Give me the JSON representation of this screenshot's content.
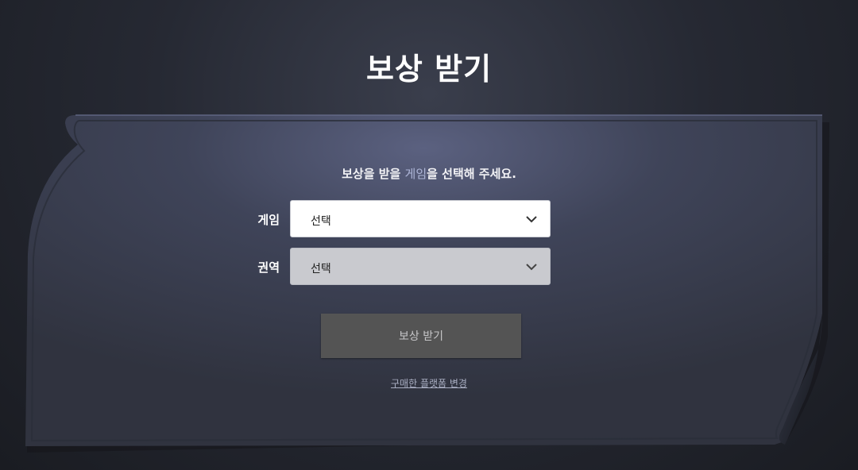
{
  "page": {
    "title": "보상 받기"
  },
  "form": {
    "instruction_prefix": "보상을 받을 ",
    "instruction_highlight": "게임",
    "instruction_suffix": "을 선택해 주세요.",
    "game_label": "게임",
    "game_value": "선택",
    "game_enabled": true,
    "region_label": "권역",
    "region_value": "선택",
    "region_enabled": false,
    "submit_label": "보상 받기",
    "submit_enabled": false,
    "change_platform_link": "구매한 플랫폼 변경"
  },
  "icons": {
    "dropdown": "chevron-down-icon"
  },
  "colors": {
    "background": "#1c1e25",
    "panel": "#3a3f55",
    "select_enabled": "#ffffff",
    "select_disabled": "#c9cacf",
    "button_disabled": "#545454",
    "highlight_text": "#aeb6d8"
  }
}
